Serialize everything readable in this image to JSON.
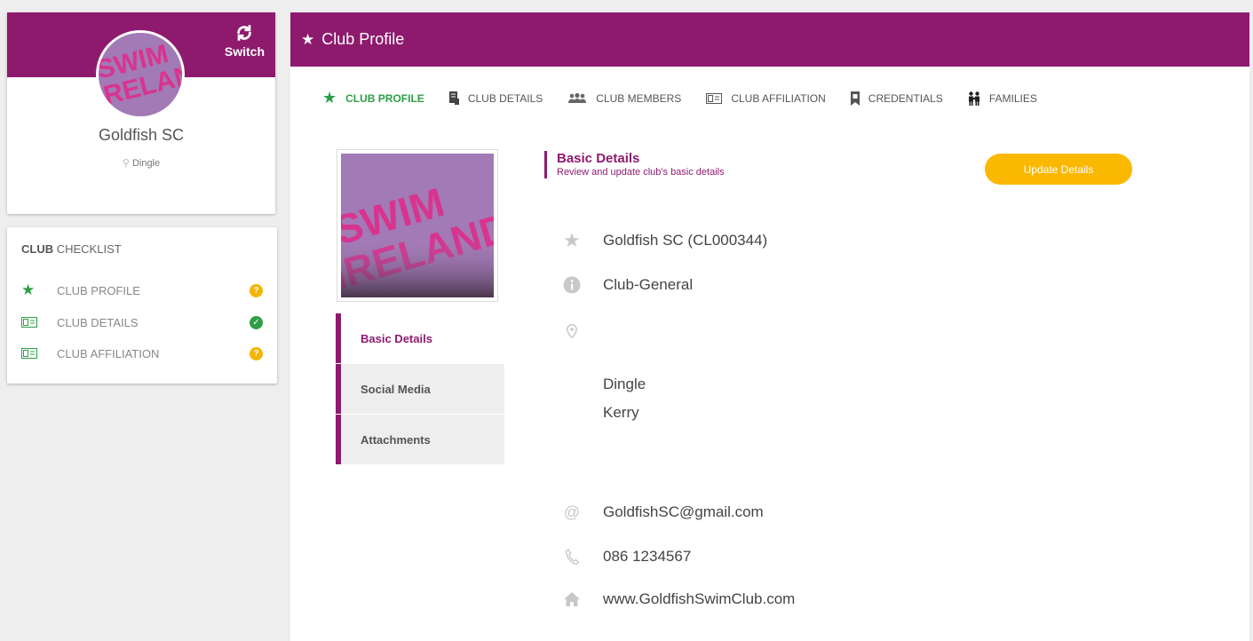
{
  "club_card": {
    "switch_label": "Switch",
    "club_name": "Goldfish SC",
    "location": "Dingle",
    "logo_text_1": "SWIM",
    "logo_text_2": "IRELAND"
  },
  "checklist": {
    "title_bold": "CLUB",
    "title_rest": " CHECKLIST",
    "items": [
      {
        "label": "CLUB PROFILE",
        "status": "pending",
        "icon": "star-icon"
      },
      {
        "label": "CLUB DETAILS",
        "status": "complete",
        "icon": "id-card-icon"
      },
      {
        "label": "CLUB AFFILIATION",
        "status": "pending",
        "icon": "id-card-icon"
      }
    ]
  },
  "main": {
    "title": "Club Profile",
    "tabs": [
      {
        "label": "CLUB PROFILE",
        "icon": "star-icon",
        "active": true
      },
      {
        "label": "CLUB DETAILS",
        "icon": "document-icon",
        "active": false
      },
      {
        "label": "CLUB MEMBERS",
        "icon": "users-icon",
        "active": false
      },
      {
        "label": "CLUB AFFILIATION",
        "icon": "id-card-icon",
        "active": false
      },
      {
        "label": "CREDENTIALS",
        "icon": "bookmark-icon",
        "active": false
      },
      {
        "label": "FAMILIES",
        "icon": "family-icon",
        "active": false
      }
    ],
    "side_menu": [
      {
        "label": "Basic Details",
        "active": true
      },
      {
        "label": "Social Media",
        "active": false
      },
      {
        "label": "Attachments",
        "active": false
      }
    ],
    "section": {
      "title": "Basic Details",
      "subtitle": "Review and update club's basic details"
    },
    "update_button": "Update Details",
    "details": {
      "name": "Goldfish SC (CL000344)",
      "type": "Club-General",
      "address_line_1": "Dingle",
      "address_line_2": "Kerry",
      "email": "GoldfishSC@gmail.com",
      "phone": "086 1234567",
      "website": "www.GoldfishSwimClub.com"
    }
  },
  "colors": {
    "brand": "#8e1a6e",
    "accent_green": "#2e9e46",
    "warning": "#f5b400",
    "button": "#fbb800"
  }
}
